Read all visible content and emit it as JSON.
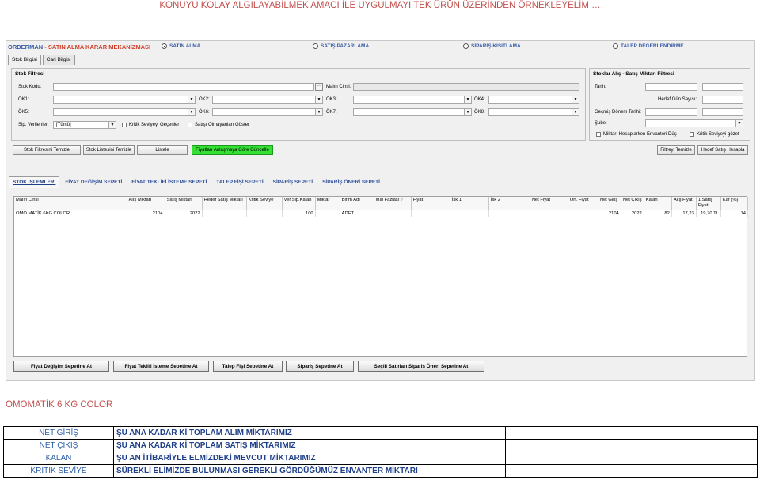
{
  "page_title": "KONUYU KOLAY ALGILAYABİLMEK AMACI İLE UYGULMAYI TEK ÜRÜN ÜZERİNDEN ÖRNEKLEYELİM …",
  "modebar": {
    "title_main": "ORDERMAN",
    "title_accent": " - SATIN ALMA KARAR MEKANİZMASI",
    "modes": [
      "SATIN ALMA",
      "SATIŞ PAZARLAMA",
      "SİPARİŞ KISITLAMA",
      "TALEP DEĞERLENDİRME"
    ],
    "selected_mode": "SATIN ALMA"
  },
  "top_tabs": [
    "Stok Bilgisi",
    "Cari Bilgisi"
  ],
  "stock_filter": {
    "title": "Stok Filtresi",
    "labels": {
      "stok_kodu": "Stok Kodu:",
      "malin_cinsi": "Malın Cinsi:",
      "ok1": "ÖK1:",
      "ok2": "ÖK2:",
      "ok3": "ÖK3:",
      "ok4": "ÖK4:",
      "ok5": "ÖK5:",
      "ok6": "ÖK6:",
      "ok7": "ÖK7:",
      "ok8": "ÖK8:",
      "sip_verilenler": "Sip. Verilenler:"
    },
    "sip_verilenler_value": "[Tümü]",
    "ellipsis": "···",
    "checkboxes": [
      "Kritik Seviyeyi Geçenler",
      "Satışı Olmayanları Göster"
    ]
  },
  "sales_filter": {
    "title": "Stoklar Alış - Satış Miktarı Filtresi",
    "labels": {
      "tarih": "Tarih:",
      "hedef_gun": "Hedef Gün Sayısı:",
      "gecmis_donem": "Geçmiş Dönem Tarihi:",
      "sube": "Şube:"
    },
    "checkboxes": [
      "Miktarı Hesaplarken Envanteri Düş",
      "Kritik Seviyeyi gözet"
    ]
  },
  "action_buttons": {
    "stok_filtresini_temizle": "Stok Filtresini Temizle",
    "stok_listesini_temizle": "Stok Listesini Temizle",
    "listele": "Listele",
    "fiyatlari_guncelle": "Fiyatları Anlaşmaya Göre Güncelle",
    "filtreyi_temizle": "Filtreyi Temizle",
    "hedef_satis_hesapla": "Hedef Satış Hesapla"
  },
  "section_tabs": [
    "STOK İŞLEMLERİ",
    "FİYAT DEĞİŞİM SEPETİ",
    "FİYAT TEKLİFİ İSTEME SEPETİ",
    "TALEP FİŞİ SEPETİ",
    "SİPARİŞ SEPETİ",
    "SİPARİŞ ÖNERİ SEPETİ"
  ],
  "grid": {
    "columns": [
      "Malın Cinsi",
      "Alış Miktarı",
      "Satış Miktarı",
      "Hedef Satış Miktarı",
      "Kritik Seviye",
      "Ver.Sip.Kalan",
      "Miktar",
      "Birim Adı",
      "Mal Fazlası",
      "Fiyat",
      "İsk 1",
      "İsk 2",
      "Net Fiyat",
      "Ort. Fiyat",
      "Net Giriş",
      "Net Çıkış",
      "Kalan",
      "Alış Fiyatı",
      "1.Satış Fiyatı",
      "Kar (%)"
    ],
    "filter_icon": "filter-icon",
    "rows": [
      [
        "OMO MATİK 6KG.COLOR",
        "2104",
        "2022",
        "",
        "",
        "100",
        "",
        "ADET",
        "",
        "",
        "",
        "",
        "",
        "",
        "2104",
        "2022",
        "82",
        "17,23",
        "19,70 TL",
        "14"
      ]
    ]
  },
  "bottom_buttons": [
    "Fiyat Değişim Sepetine At",
    "Fiyat Teklifi İsteme Sepetine At",
    "Talep Fişi Sepetine At",
    "Sipariş Sepetine At",
    "Seçili Satırları Sipariş Öneri Sepetine At"
  ],
  "product_heading": "OMOMATİK 6 KG COLOR",
  "legend": [
    {
      "key": "NET GİRİŞ",
      "desc": "ŞU ANA KADAR Kİ TOPLAM ALIM MİKTARIMIZ"
    },
    {
      "key": "NET ÇIKIŞ",
      "desc": "ŞU ANA KADAR Kİ TOPLAM SATIŞ MİKTARIMIZ"
    },
    {
      "key": "KALAN",
      "desc": "ŞU AN İTİBARİYLE ELMİZDEKİ MEVCUT MİKTARIMIZ"
    },
    {
      "key": "KRITIK SEVİYE",
      "desc": "SÜREKLİ ELİMİZDE BULUNMASI GEREKLİ GÖRDÜĞÜMÜZ ENVANTER MİKTARI"
    }
  ]
}
